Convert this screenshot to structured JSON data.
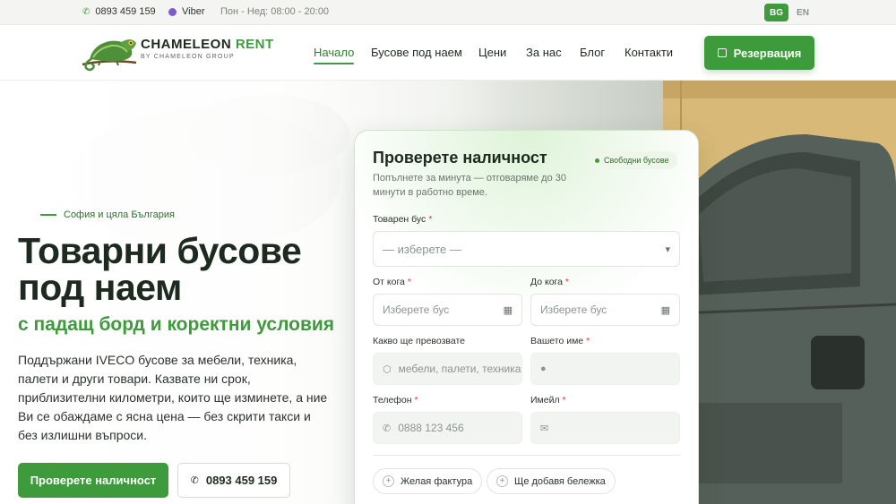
{
  "topbar": {
    "phone": "0893 459 159",
    "viber": "Viber",
    "hours": "Пон - Нед: 08:00 - 20:00",
    "lang_active": "BG",
    "lang_other": "EN"
  },
  "header": {
    "brand_main": "CHAMELEON",
    "brand_accent": "RENT",
    "brand_sub": "BY CHAMELEON GROUP",
    "nav": [
      "Начало",
      "Бусове под наем",
      "Цени",
      "За нас",
      "Блог",
      "Контакти"
    ],
    "nav_active_index": 0,
    "reserve_label": "Резервация"
  },
  "hero": {
    "eyebrow": "София и цяла България",
    "title": "Товарни бусове под наем",
    "subtitle": "с падащ борд и коректни условия",
    "lead": "Поддържани IVECO бусове за мебели, техника, палети и други товари. Казвате ни срок, приблизителни километри, които ще изминете, а ние Ви се обаждаме с ясна цена — без скрити такси и без излишни въпроси.",
    "cta_primary": "Проверете наличност",
    "cta_phone": "0893 459 159"
  },
  "form": {
    "title": "Проверете наличност",
    "badge": "Свободни бусове",
    "subtitle": "Попълнете за минута — отговаряме до 30 минути в работно време.",
    "bus_label": "Товарен бус",
    "bus_placeholder": "— изберете —",
    "from_label": "От кога",
    "from_placeholder": "Изберете бус",
    "to_label": "До кога",
    "to_placeholder": "Изберете бус",
    "cargo_label": "Какво ще превозвате",
    "cargo_placeholder": "мебели, палети, техника",
    "name_label": "Вашето име",
    "name_placeholder": "",
    "phone_label": "Телефон",
    "phone_placeholder": "0888 123 456",
    "email_label": "Имейл",
    "email_placeholder": "",
    "invoice_chip": "Желая фактура",
    "note_chip": "Ще добавя бележка",
    "required_mark": "*"
  },
  "colors": {
    "brand_green": "#3e9b3c",
    "dark_text": "#1d2a1f",
    "required": "#d43c3c"
  }
}
